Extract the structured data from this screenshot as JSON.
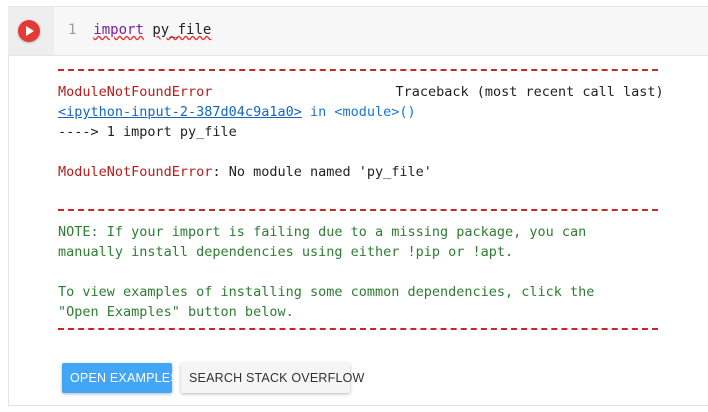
{
  "code_cell": {
    "line_number": "1",
    "keyword": "import",
    "module": "py_file",
    "run_icon": "play-icon"
  },
  "traceback": {
    "error_name": "ModuleNotFoundError",
    "traceback_label": "Traceback (most recent call last)",
    "input_link": "<ipython-input-2-387d04c9a1a0>",
    "in_text": "in",
    "module_ref": "<module>",
    "module_parens": "()",
    "arrow_line": "----> 1 import py_file",
    "error_colon": "ModuleNotFoundError",
    "error_message": ": No module named 'py_file'"
  },
  "note": {
    "line1": "NOTE: If your import is failing due to a missing package, you can",
    "line2": "manually install dependencies using either !pip or !apt.",
    "line3": "To view examples of installing some common dependencies, click the",
    "line4": "\"Open Examples\" button below."
  },
  "buttons": {
    "open_examples": "OPEN EXAMPLES",
    "search_stack_overflow": "SEARCH STACK OVERFLOW"
  },
  "colors": {
    "run_button": "#e53935",
    "error_red": "#b71c1c",
    "note_green": "#2e7d32",
    "link_blue": "#1565c0",
    "primary_button": "#42a5f5"
  }
}
